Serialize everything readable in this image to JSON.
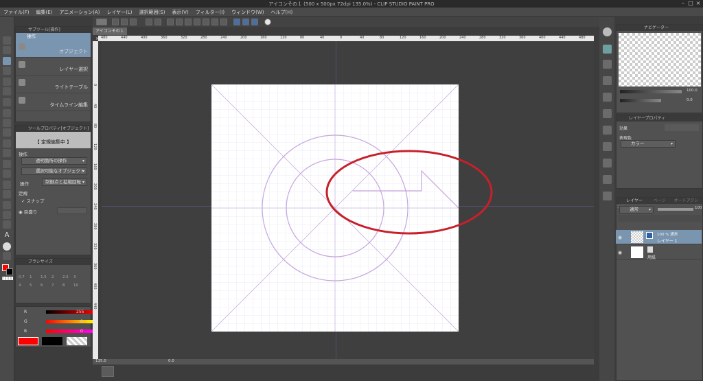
{
  "window": {
    "title": "アイコンその１ (500 x 500px 72dpi 135.0%) - CLIP STUDIO PAINT PRO"
  },
  "menu": [
    "ファイル(F)",
    "編集(E)",
    "アニメーション(A)",
    "レイヤー(L)",
    "選択範囲(S)",
    "表示(V)",
    "フィルター(I)",
    "ウィンドウ(W)",
    "ヘルプ(H)"
  ],
  "canvas_tab": "アイコンその１",
  "subtool_panel": {
    "header": "サブツール[操作]",
    "group": "操作",
    "items": [
      "オブジェクト",
      "レイヤー選択",
      "ライトテーブル",
      "タイムライン編集"
    ]
  },
  "tool_property": {
    "header": "ツールプロパティ[オブジェクト]",
    "banner": "【 定規編集中 】",
    "section_operation": "操作",
    "dropdown_transparent": "透明箇所の操作",
    "dropdown_selectable": "選択可能なオブジェクト",
    "operation_label": "操作",
    "operation_value": "制御点と拡縮回転",
    "ruler_label": "定規",
    "snap_label": "スナップ",
    "scale_label": "目盛り"
  },
  "brush_size_header": "ブラシサイズ",
  "brush_sizes": [
    "0.7",
    "1",
    "1.5",
    "2",
    "2.5",
    "3",
    "4",
    "5",
    "6",
    "7",
    "8",
    "10"
  ],
  "color_slider": {
    "r_label": "R",
    "r_value": "255",
    "g_label": "G",
    "g_value": "0",
    "b_label": "B",
    "b_value": "0"
  },
  "colors": {
    "main": "#ff0000",
    "sub": "#000000",
    "accent": "#7a95b0",
    "highlight_ellipse": "#c8202a"
  },
  "ruler_h_ticks": [
    "480",
    "440",
    "400",
    "360",
    "320",
    "280",
    "240",
    "200",
    "160",
    "120",
    "80",
    "40",
    "0",
    "40",
    "80",
    "120",
    "160",
    "200",
    "240",
    "280",
    "320",
    "360",
    "400",
    "440",
    "480"
  ],
  "ruler_v_ticks": [
    "0",
    "40",
    "80",
    "120",
    "160",
    "200",
    "240",
    "280",
    "320",
    "360",
    "400",
    "440"
  ],
  "navigator": {
    "header": "ナビゲーター",
    "zoom": "100.0",
    "rotate": "0.0"
  },
  "layer_property": {
    "header": "レイヤープロパティ",
    "effect_label": "効果",
    "expression_label": "表現色",
    "expression_value": "カラー"
  },
  "layer_panel": {
    "tabs": [
      "レイヤー",
      "ページ",
      "オートアクション"
    ],
    "blend_mode": "通常",
    "opacity": "100",
    "layers": [
      {
        "meta": "100 % 通常",
        "name": "レイヤー 1"
      },
      {
        "meta": "",
        "name": "用紙"
      }
    ]
  },
  "status": {
    "zoom": "135.0",
    "angle": "0.0"
  }
}
